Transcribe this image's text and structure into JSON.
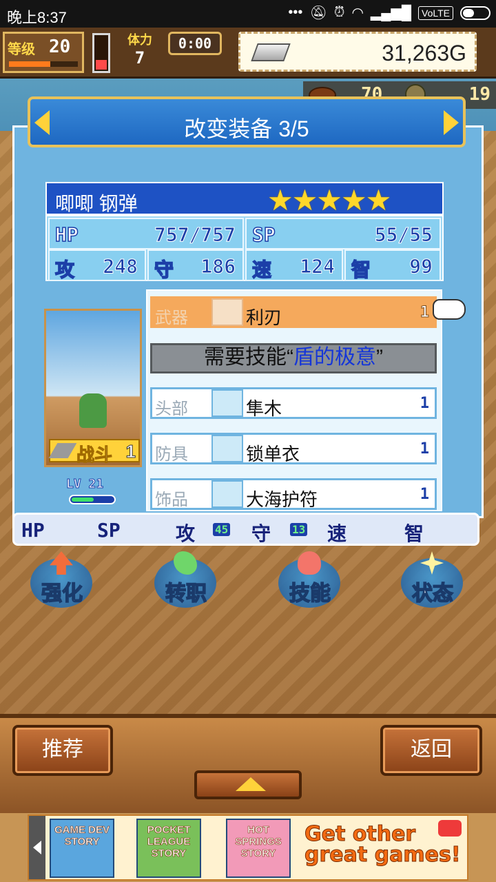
{
  "status_bar": {
    "time": "晚上8:37",
    "icons": [
      "dots-icon",
      "mute-icon",
      "alarm-icon",
      "wifi-icon",
      "signal-icon"
    ],
    "volte": "VoLTE",
    "battery_level": 0.3
  },
  "hud": {
    "level_label": "等级",
    "level_value": "20",
    "level_progress": 0.6,
    "stamina_fill": 0.25,
    "rest_label": "体力",
    "rest_value": "7",
    "clock": "0:00",
    "gold": "31,263G",
    "ball_count": "70",
    "coin_count": "19"
  },
  "title": "改变装备 3/5",
  "character": {
    "name": "唧唧 钢弹",
    "stars": "★★★★★",
    "hp_label": "HP",
    "hp_value": "757/757",
    "sp_label": "SP",
    "sp_value": "55/55",
    "atk_label": "攻",
    "atk_value": "248",
    "def_label": "守",
    "def_value": "186",
    "spd_label": "速",
    "spd_value": "124",
    "int_label": "智",
    "int_value": "99",
    "job": "战斗",
    "job_level": "1",
    "level_tag": "LV 21",
    "exp_progress": 0.5
  },
  "equipment": {
    "lv_label": "LV",
    "slots": [
      {
        "category": "武器",
        "item": "利刃",
        "qty": "1",
        "selected": true
      },
      {
        "category": "头部",
        "item": "隼木",
        "qty": "1",
        "selected": false
      },
      {
        "category": "防具",
        "item": "锁单衣",
        "qty": "1",
        "selected": false
      },
      {
        "category": "饰品",
        "item": "大海护符",
        "qty": "1",
        "selected": false
      }
    ],
    "requirement_prefix": "需要技能“",
    "requirement_skill": "盾的极意",
    "requirement_suffix": "”"
  },
  "diff_bar": {
    "hp": "HP",
    "sp": "SP",
    "atk": "攻",
    "atk_delta": "45",
    "def": "守",
    "def_delta": "13",
    "spd": "速",
    "int": "智"
  },
  "actions": [
    {
      "label": "强化",
      "icon": "arrow-up-icon",
      "color": "#f26d3b"
    },
    {
      "label": "转职",
      "icon": "green-gem-icon",
      "color": "#6fd66a"
    },
    {
      "label": "技能",
      "icon": "flame-icon",
      "color": "#f3756a"
    },
    {
      "label": "状态",
      "icon": "sparkle-icon",
      "color": "#fff3a0"
    }
  ],
  "bottom": {
    "recommend": "推荐",
    "back": "返回"
  },
  "ad": {
    "games": [
      "GAME DEV STORY",
      "POCKET LEAGUE STORY",
      "HOT SPRINGS STORY"
    ],
    "cta": "Get other great games!"
  }
}
